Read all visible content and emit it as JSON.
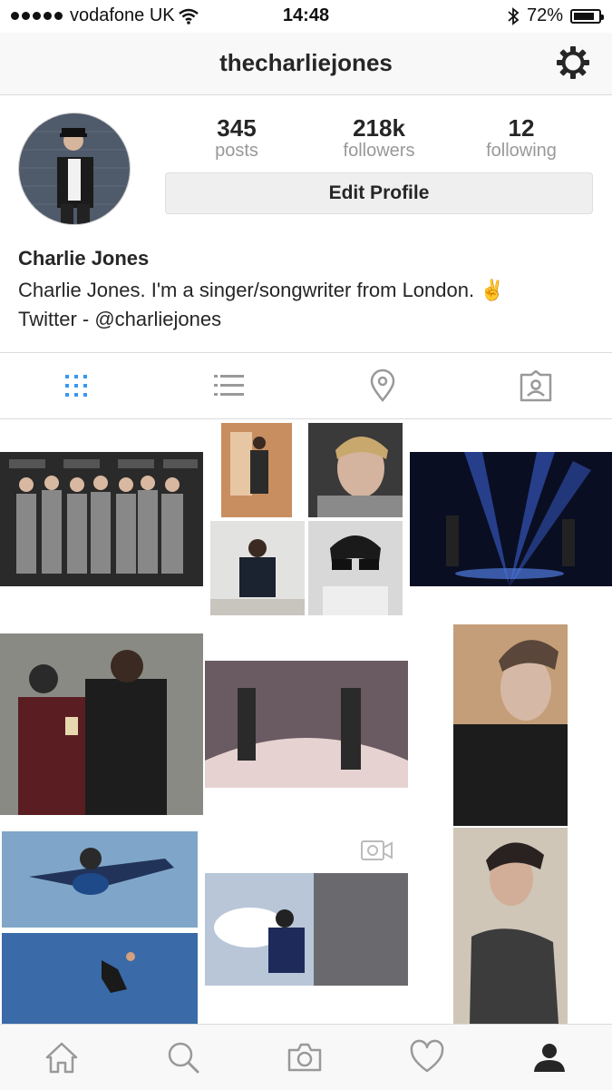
{
  "status": {
    "carrier": "vodafone UK",
    "time": "14:48",
    "battery": "72%"
  },
  "header": {
    "username": "thecharliejones"
  },
  "stats": [
    {
      "value": "345",
      "label": "posts"
    },
    {
      "value": "218k",
      "label": "followers"
    },
    {
      "value": "12",
      "label": "following"
    }
  ],
  "edit_label": "Edit Profile",
  "bio": {
    "name": "Charlie Jones",
    "line1": "Charlie Jones. I'm a singer/songwriter from London. ✌",
    "line2": "Twitter - @charliejones"
  },
  "tabs": [
    "grid-icon",
    "list-icon",
    "location-pin-icon",
    "tagged-icon"
  ],
  "bottom_nav": [
    "home-icon",
    "search-icon",
    "camera-icon",
    "heart-icon",
    "profile-icon"
  ],
  "colors": {
    "accent": "#3897f0",
    "muted": "#999999",
    "border": "#dbdbdb",
    "bar": "#f8f8f8"
  }
}
